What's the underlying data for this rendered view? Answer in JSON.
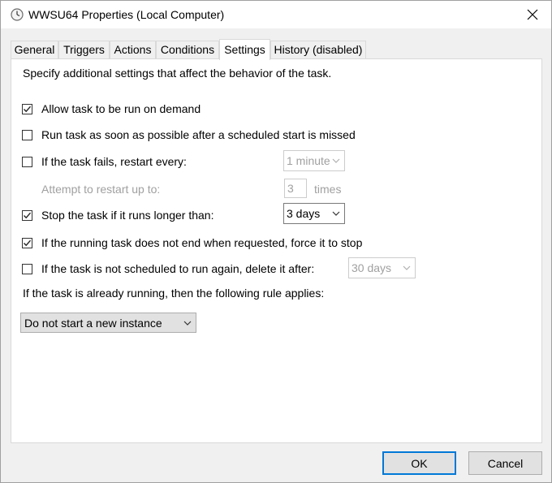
{
  "window": {
    "title": "WWSU64 Properties (Local Computer)",
    "icon": "clock-icon",
    "close_icon": "close-icon"
  },
  "tabs": [
    {
      "label": "General"
    },
    {
      "label": "Triggers"
    },
    {
      "label": "Actions"
    },
    {
      "label": "Conditions"
    },
    {
      "label": "Settings"
    },
    {
      "label": "History (disabled)"
    }
  ],
  "active_tab": "Settings",
  "settings": {
    "description": "Specify additional settings that affect the behavior of the task.",
    "allow_on_demand": {
      "label": "Allow task to be run on demand",
      "checked": true
    },
    "run_asap": {
      "label": "Run task as soon as possible after a scheduled start is missed",
      "checked": false
    },
    "restart_fail": {
      "label": "If the task fails, restart every:",
      "checked": false,
      "interval": "1 minute"
    },
    "restart_attempts": {
      "label": "Attempt to restart up to:",
      "value": "3",
      "unit": "times"
    },
    "stop_longer": {
      "label": "Stop the task if it runs longer than:",
      "checked": true,
      "value": "3 days"
    },
    "force_stop": {
      "label": "If the running task does not end when requested, force it to stop",
      "checked": true
    },
    "delete_after": {
      "label": "If the task is not scheduled to run again, delete it after:",
      "checked": false,
      "value": "30 days"
    },
    "rule_label": "If the task is already running, then the following rule applies:",
    "rule_value": "Do not start a new instance"
  },
  "buttons": {
    "ok": "OK",
    "cancel": "Cancel"
  }
}
